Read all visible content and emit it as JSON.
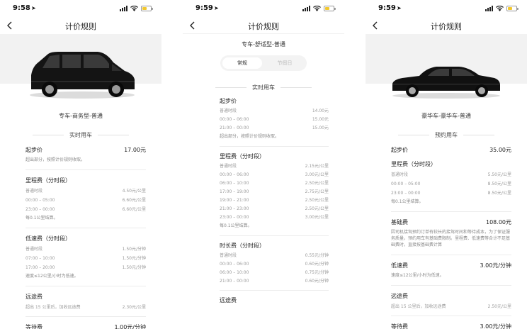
{
  "status_bar": [
    {
      "time": "9:58"
    },
    {
      "time": "9:59"
    },
    {
      "time": "9:59"
    }
  ],
  "nav_title": "计价规则",
  "colors": {
    "battery": "#f2c830",
    "text_grey": "#9a9a9a",
    "hero_bg": "#f2f2f2"
  },
  "icons": {
    "back": "chevron-left-icon",
    "location": "location-arrow-icon",
    "signal": "signal-icon",
    "wifi": "wifi-icon",
    "battery": "battery-icon"
  },
  "screen1": {
    "car_model": "专车-商务型-普通",
    "section": "实时用车",
    "start": {
      "label": "起步价",
      "value": "17.00元",
      "note": "超出部分，按照计价规则收取。"
    },
    "mileage": {
      "label": "里程费（分时段）",
      "rows": [
        {
          "k": "普通时段",
          "v": "4.50元/公里"
        },
        {
          "k": "00:00 – 05:00",
          "v": "6.60元/公里"
        },
        {
          "k": "23:00 – 00:00",
          "v": "6.60元/公里"
        }
      ],
      "note": "每0.1公里结算。"
    },
    "lowspeed": {
      "label": "低速费（分时段）",
      "rows": [
        {
          "k": "普通时段",
          "v": "1.50元/分钟"
        },
        {
          "k": "07:00 – 10:00",
          "v": "1.50元/分钟"
        },
        {
          "k": "17:00 – 20:00",
          "v": "1.50元/分钟"
        }
      ],
      "note": "速度≤12公里/小时为低速。"
    },
    "longdist": {
      "label": "远途费",
      "rows": [
        {
          "k": "超出 15 公里后，加收远途费",
          "v": "2.30元/公里"
        }
      ]
    },
    "wait": {
      "label": "等待费",
      "value": "1.00元/分钟"
    }
  },
  "screen2": {
    "car_model": "专车-舒适型-普通",
    "toggle": {
      "active": "常规",
      "inactive": "节假日"
    },
    "section": "实时用车",
    "start": {
      "label": "起步价",
      "rows": [
        {
          "k": "普通时段",
          "v": "14.00元"
        },
        {
          "k": "00:00 – 06:00",
          "v": "15.00元"
        },
        {
          "k": "21:00 – 00:00",
          "v": "15.00元"
        }
      ],
      "note": "超出部分，按照计价规则收取。"
    },
    "mileage": {
      "label": "里程费（分时段）",
      "rows": [
        {
          "k": "普通时段",
          "v": "2.15元/公里"
        },
        {
          "k": "00:00 – 06:00",
          "v": "3.00元/公里"
        },
        {
          "k": "06:00 – 10:00",
          "v": "2.50元/公里"
        },
        {
          "k": "17:00 – 19:00",
          "v": "2.75元/公里"
        },
        {
          "k": "19:00 – 21:00",
          "v": "2.50元/公里"
        },
        {
          "k": "21:00 – 23:00",
          "v": "2.50元/公里"
        },
        {
          "k": "23:00 – 00:00",
          "v": "3.00元/公里"
        }
      ],
      "note": "每0.1公里结算。"
    },
    "duration": {
      "label": "时长费（分时段）",
      "rows": [
        {
          "k": "普通时段",
          "v": "0.55元/分钟"
        },
        {
          "k": "00:00 – 06:00",
          "v": "0.60元/分钟"
        },
        {
          "k": "06:00 – 10:00",
          "v": "0.75元/分钟"
        },
        {
          "k": "21:00 – 00:00",
          "v": "0.60元/分钟"
        }
      ]
    },
    "longdist": {
      "label": "远途费"
    }
  },
  "screen3": {
    "car_model": "豪华车-豪华车-普通",
    "section": "预约用车",
    "start": {
      "label": "起步价",
      "value": "35.00元"
    },
    "mileage": {
      "label": "里程费（分时段）",
      "rows": [
        {
          "k": "普通时段",
          "v": "5.50元/公里"
        },
        {
          "k": "00:00 – 05:00",
          "v": "8.50元/公里"
        },
        {
          "k": "23:00 – 00:00",
          "v": "8.50元/公里"
        }
      ],
      "note": "每0.1公里结算。"
    },
    "base": {
      "label": "基础费",
      "value": "108.00元",
      "note": "因司机接驾预约订单有较长的接驾时间和等待成本，为了保证服务质量，预约用车有基础费限制。里程费、低速费等合计不足基础费时，直接按基础费计算"
    },
    "lowspeed": {
      "label": "低速费",
      "value": "3.00元/分钟",
      "note": "速度≤12公里/小时为低速。"
    },
    "longdist": {
      "label": "远途费",
      "rows": [
        {
          "k": "超出 15 公里后，加收远途费",
          "v": "2.50元/公里"
        }
      ]
    },
    "wait": {
      "label": "等待费",
      "value": "3.00元/分钟"
    }
  }
}
